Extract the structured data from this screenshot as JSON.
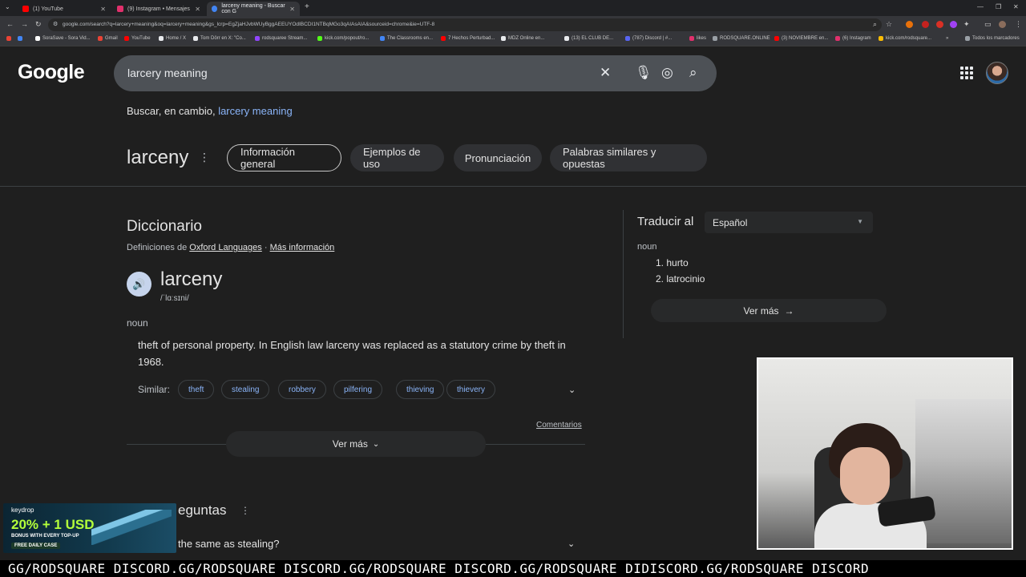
{
  "browser": {
    "tabs": [
      {
        "label": "(1) YouTube",
        "color": "#ff0000"
      },
      {
        "label": "(9) Instagram • Mensajes",
        "color": "#e1306c"
      },
      {
        "label": "larceny meaning - Buscar con G",
        "color": "#4285f4"
      }
    ],
    "url": "google.com/search?q=larcery+meaning&oq=larcery+meaning&gs_lcrp=EgZjaHJvbWUyBggAEEUYOdIBCDI1NTBqMGo3qAIAsAIA&sourceid=chrome&ie=UTF-8",
    "bookmarks": [
      {
        "label": "SoraSave - Sora Vid...",
        "color": "#ffffff"
      },
      {
        "label": "Gmail",
        "color": "#ea4335"
      },
      {
        "label": "YouTube",
        "color": "#ff0000"
      },
      {
        "label": "Home / X",
        "color": "#e8eaed"
      },
      {
        "label": "Tom Dörr en X: \"Co...",
        "color": "#e8eaed"
      },
      {
        "label": "rodsquaree Stream...",
        "color": "#9146ff"
      },
      {
        "label": "kick.com/popout/ro...",
        "color": "#53fc18"
      },
      {
        "label": "The Classrooms en...",
        "color": "#4285f4"
      },
      {
        "label": "7 Hechos Perturbad...",
        "color": "#ff0000"
      },
      {
        "label": "MDZ Online en...",
        "color": "#e8eaed"
      },
      {
        "label": "(13) EL CLUB DE...",
        "color": "#e8eaed"
      },
      {
        "label": "(787) Discord | #...",
        "color": "#5865f2"
      },
      {
        "label": "likes",
        "color": "#e1306c"
      },
      {
        "label": "RODSQUARE.ONLINE",
        "color": "#9aa0a6"
      },
      {
        "label": "(3) NOVIEMBRE en...",
        "color": "#ff0000"
      },
      {
        "label": "(6) Instagram",
        "color": "#e1306c"
      },
      {
        "label": "kick.com/rodsquare...",
        "color": "#fbbc04"
      },
      {
        "label": "Todos los marcadores",
        "color": "#9aa0a6"
      }
    ]
  },
  "google": {
    "logo": "Google",
    "query": "larcery meaning",
    "spell_prefix": "Buscar, en cambio,",
    "spell_link": "larcery meaning",
    "word": "larceny",
    "chips": [
      "Información general",
      "Ejemplos de uso",
      "Pronunciación",
      "Palabras similares y opuestas"
    ]
  },
  "dictionary": {
    "title": "Diccionario",
    "source_prefix": "Definiciones de",
    "source_link": "Oxford Languages",
    "more_info": "Más información",
    "headword": "larceny",
    "phonetic": "/ˈlɑːsɪni/",
    "pos": "noun",
    "definition": "theft of personal property. In English law larceny was replaced as a statutory crime by theft in 1968.",
    "similar_label": "Similar:",
    "similar": [
      "theft",
      "stealing",
      "robbery",
      "pilfering",
      "thieving",
      "thievery"
    ],
    "feedback": "Comentarios",
    "ver_mas": "Ver más"
  },
  "translate": {
    "label": "Traducir al",
    "language": "Español",
    "pos": "noun",
    "items": [
      "1. hurto",
      "2. latrocinio"
    ],
    "ver_mas": "Ver más"
  },
  "people_also_ask": {
    "title_fragment": "eguntas",
    "question_fragment": "the same as stealing?"
  },
  "ad": {
    "brand": "keydrop",
    "headline": "20% + 1 USD",
    "subline": "BONUS WITH EVERY TOP-UP",
    "badge": "FREE DAILY CASE"
  },
  "ticker": "GG/RODSQUARE DISCORD.GG/RODSQUARE DISCORD.GG/RODSQUARE DISCORD.GG/RODSQUARE DIDISCORD.GG/RODSQUARE DISCORD"
}
